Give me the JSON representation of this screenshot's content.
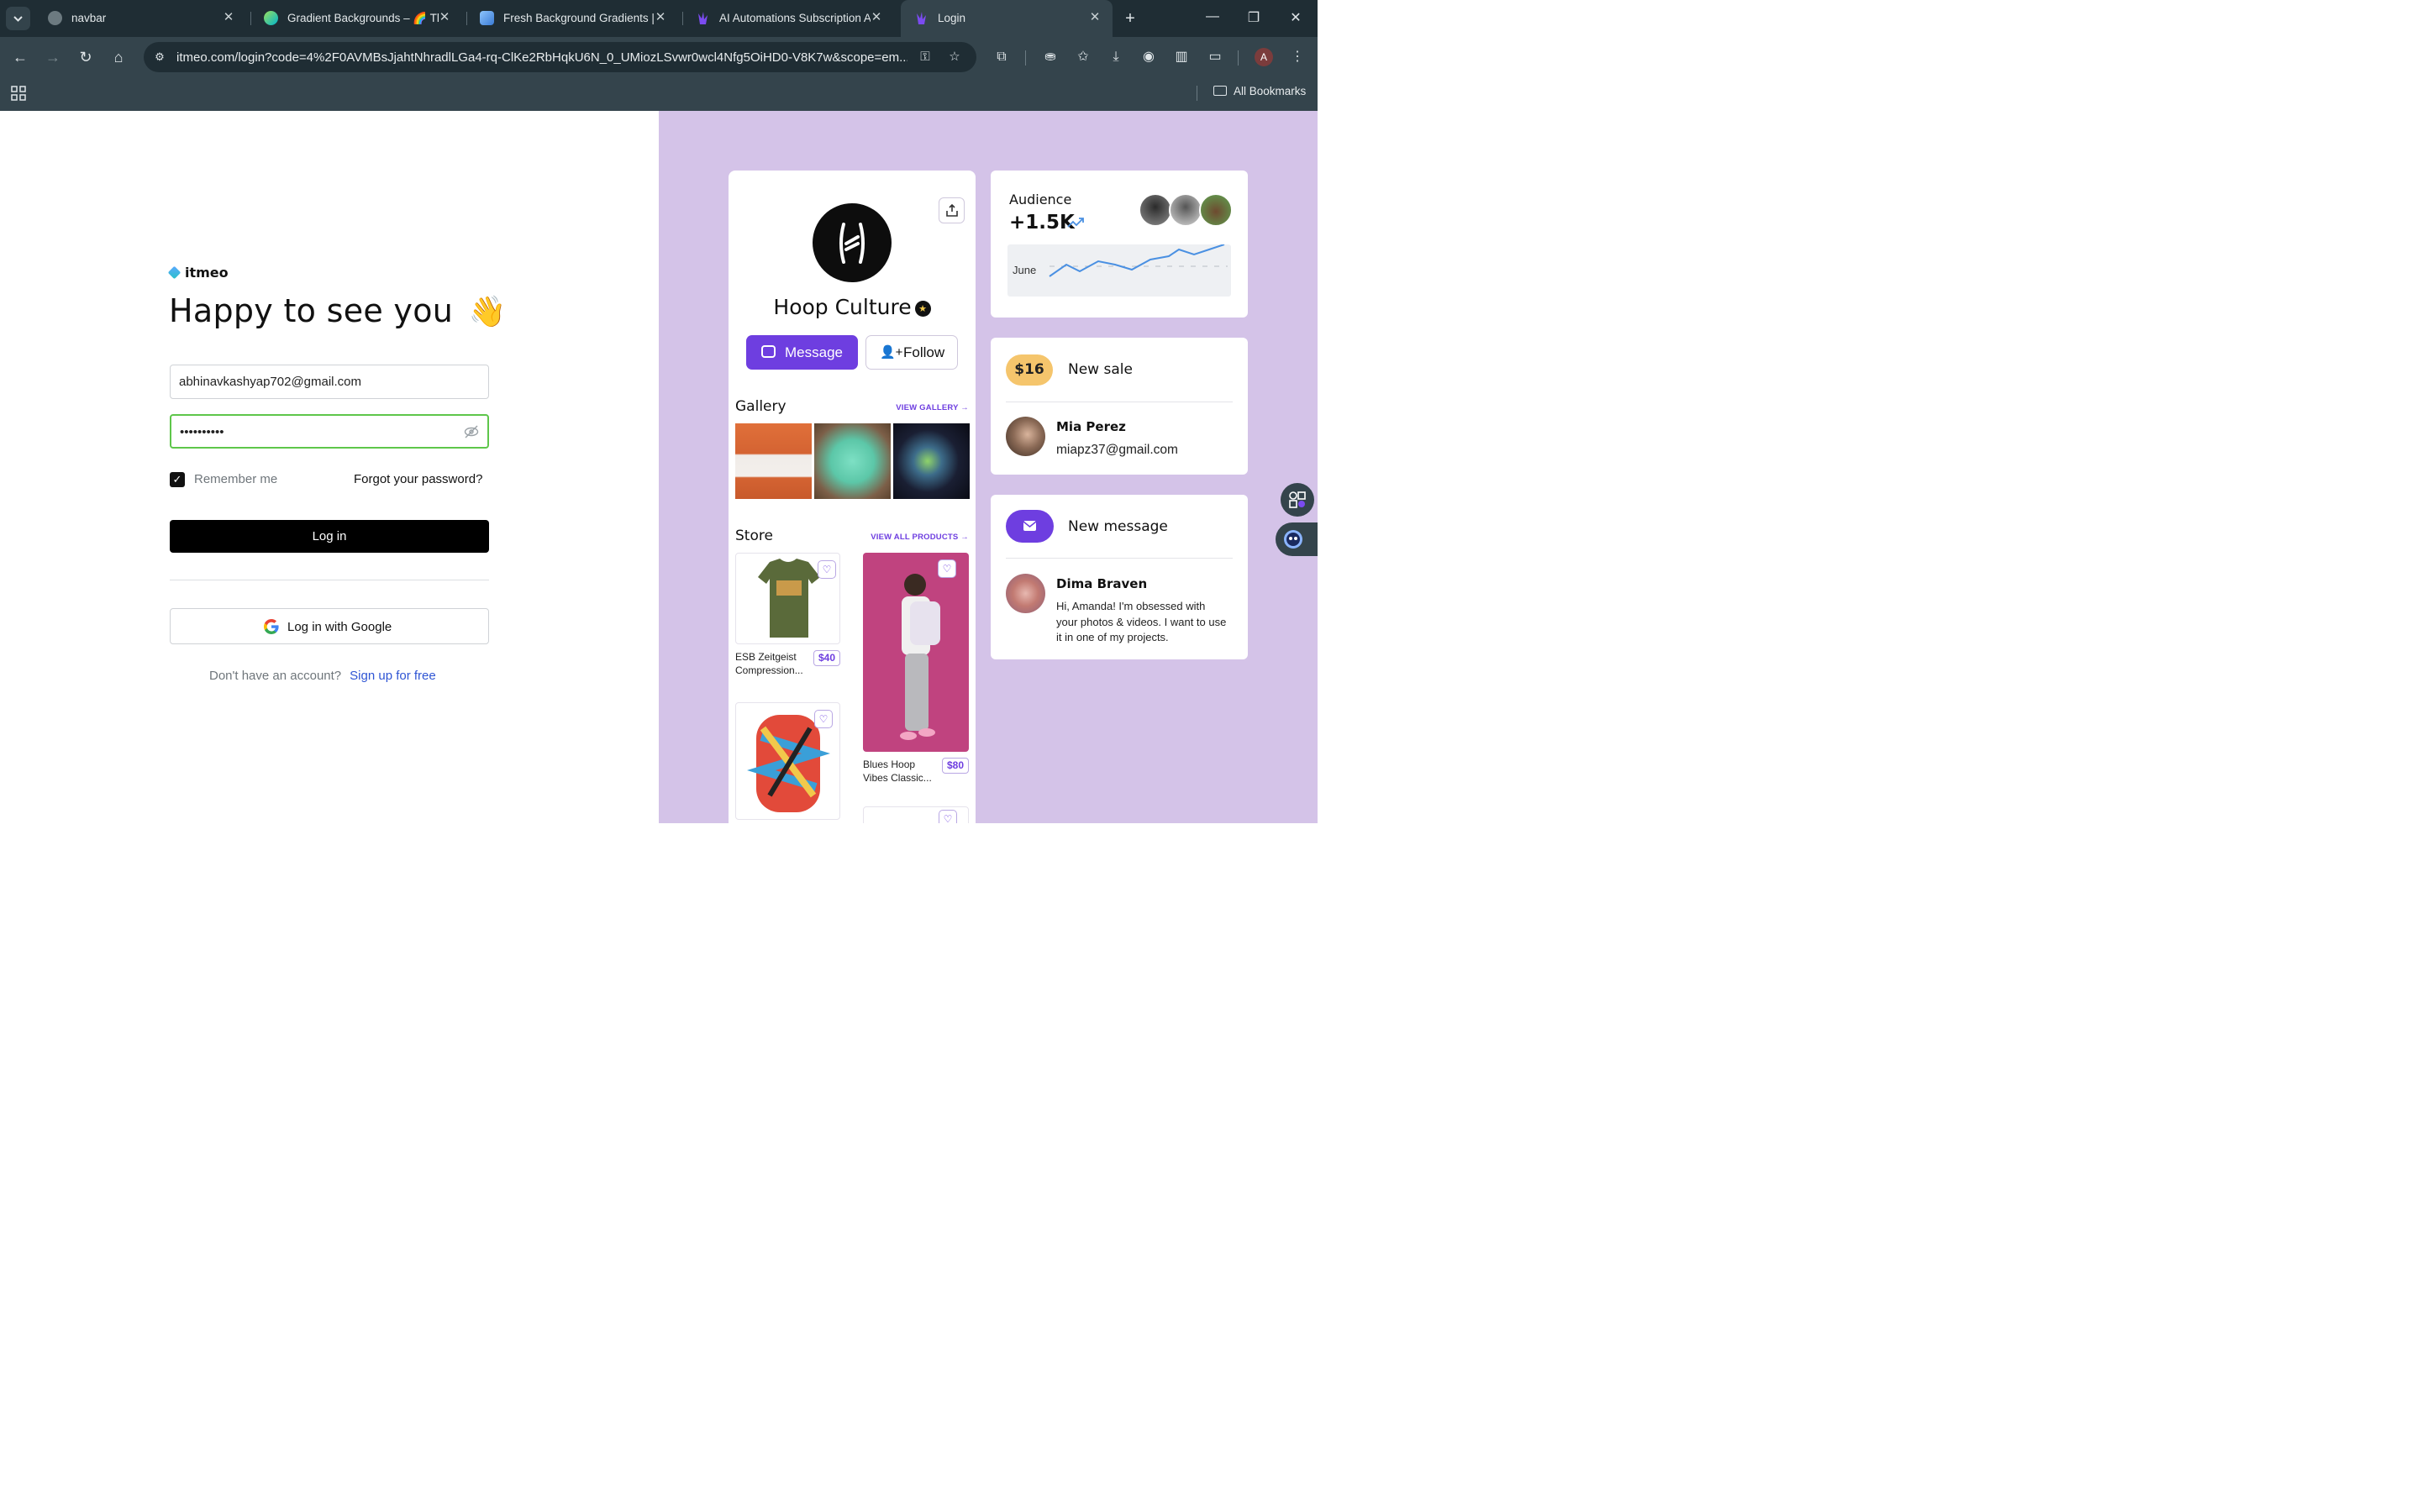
{
  "browser": {
    "tabs": [
      {
        "title": "navbar"
      },
      {
        "title": "Gradient Backgrounds – 🌈 The"
      },
      {
        "title": "Fresh Background Gradients | W"
      },
      {
        "title": "AI Automations Subscription Ag"
      },
      {
        "title": "Login"
      }
    ],
    "url": "itmeo.com/login?code=4%2F0AVMBsJjahtNhradlLGa4-rq-ClKe2RbHqkU6N_0_UMiozLSvwr0wcl4Nfg5OiHD0-V8K7w&scope=em...",
    "profile_initial": "A",
    "all_bookmarks": "All Bookmarks"
  },
  "login": {
    "brand": "itmeo",
    "heading": "Happy to see you",
    "heading_emoji": "👋",
    "email_value": "abhinavkashyap702@gmail.com",
    "password_value": "••••••••••",
    "remember_label": "Remember me",
    "forgot_label": "Forgot your password?",
    "login_button": "Log in",
    "google_button": "Log in with Google",
    "no_account": "Don't have an account?",
    "signup_link": "Sign up for free"
  },
  "profile": {
    "name": "Hoop Culture",
    "message_button": "Message",
    "follow_button": "Follow",
    "gallery_title": "Gallery",
    "gallery_link": "VIEW GALLERY",
    "store_title": "Store",
    "store_link": "VIEW ALL PRODUCTS",
    "products": [
      {
        "name": "ESB Zeitgeist Compression...",
        "line1": "ESB Zeitgeist",
        "line2": "Compression...",
        "price": "$40"
      },
      {
        "name": "Blues Hoop Vibes Classic...",
        "line1": "Blues Hoop",
        "line2": "Vibes Classic...",
        "price": "$80"
      }
    ]
  },
  "audience": {
    "title": "Audience",
    "value": "+1.5K",
    "month": "June"
  },
  "sale": {
    "amount": "$16",
    "label": "New sale",
    "person": "Mia Perez",
    "email": "miapz37@gmail.com"
  },
  "message": {
    "label": "New message",
    "person": "Dima Braven",
    "text": "Hi, Amanda! I'm obsessed with your photos & videos. I want to use it in one of my projects."
  },
  "colors": {
    "accent": "#6e3ee0",
    "panel": "#d4c3e8",
    "sale_pill": "#f5c56c",
    "password_border": "#5ec64a"
  }
}
